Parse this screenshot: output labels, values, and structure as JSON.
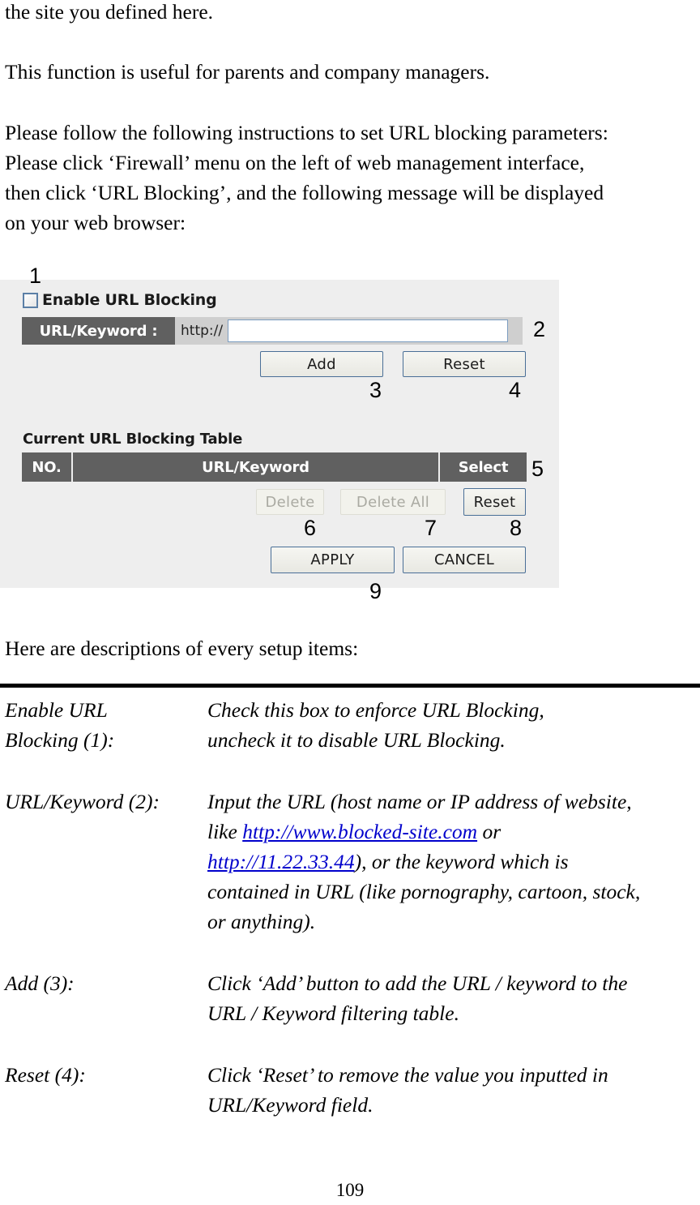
{
  "document": {
    "page_number": "109",
    "intro_paragraphs": [
      [
        "the site you defined here."
      ],
      [
        "This function is useful for parents and company managers."
      ],
      [
        "Please follow the following instructions to set URL blocking parameters:",
        "Please click ‘Firewall’ menu on the left of web management interface,",
        "then click ‘URL Blocking’, and the following message will be displayed",
        "on your web browser:"
      ]
    ],
    "descriptions_heading": "Here are descriptions of every setup items:"
  },
  "figure": {
    "enable_checkbox_label": "Enable URL Blocking",
    "url_field_label": "URL/Keyword :",
    "url_protocol_prefix": "http://",
    "url_input_value": "",
    "url_input_placeholder": "",
    "add_button": "Add",
    "reset_button_1": "Reset",
    "table_caption": "Current URL Blocking Table",
    "table_headers": [
      "NO.",
      "URL/Keyword",
      "Select"
    ],
    "table_rows": [],
    "delete_button": "Delete",
    "delete_all_button": "Delete All",
    "reset_button_2": "Reset",
    "apply_button": "APPLY",
    "cancel_button": "CANCEL",
    "callouts": {
      "c1": "1",
      "c2": "2",
      "c3": "3",
      "c4": "4",
      "c5": "5",
      "c6": "6",
      "c7": "7",
      "c8": "8",
      "c9": "9"
    }
  },
  "definitions": [
    {
      "term_lines": [
        "Enable URL",
        "Blocking (1):"
      ],
      "desc_lines": [
        [
          {
            "t": "Check this box to enforce URL Blocking,",
            "link": false
          }
        ],
        [
          {
            "t": "uncheck it to disable URL Blocking.",
            "link": false
          }
        ]
      ]
    },
    {
      "term_lines": [
        "URL/Keyword (2):"
      ],
      "desc_lines": [
        [
          {
            "t": "Input the URL (host name or IP address of website,",
            "link": false
          }
        ],
        [
          {
            "t": "like ",
            "link": false
          },
          {
            "t": "http://www.blocked-site.com",
            "link": true
          },
          {
            "t": " or",
            "link": false
          }
        ],
        [
          {
            "t": "http://11.22.33.44",
            "link": true
          },
          {
            "t": "), or the keyword which is",
            "link": false
          }
        ],
        [
          {
            "t": "contained in URL (like pornography, cartoon, stock,",
            "link": false
          }
        ],
        [
          {
            "t": "or anything).",
            "link": false
          }
        ]
      ]
    },
    {
      "term_lines": [
        "Add (3):"
      ],
      "desc_lines": [
        [
          {
            "t": "Click ‘Add’ button to add the URL / keyword to the",
            "link": false
          }
        ],
        [
          {
            "t": "URL / Keyword filtering table.",
            "link": false
          }
        ]
      ]
    },
    {
      "term_lines": [
        "Reset (4):"
      ],
      "desc_lines": [
        [
          {
            "t": "Click ‘Reset’ to remove the value you inputted in",
            "link": false
          }
        ],
        [
          {
            "t": "URL/Keyword field.",
            "link": false
          }
        ]
      ]
    }
  ]
}
